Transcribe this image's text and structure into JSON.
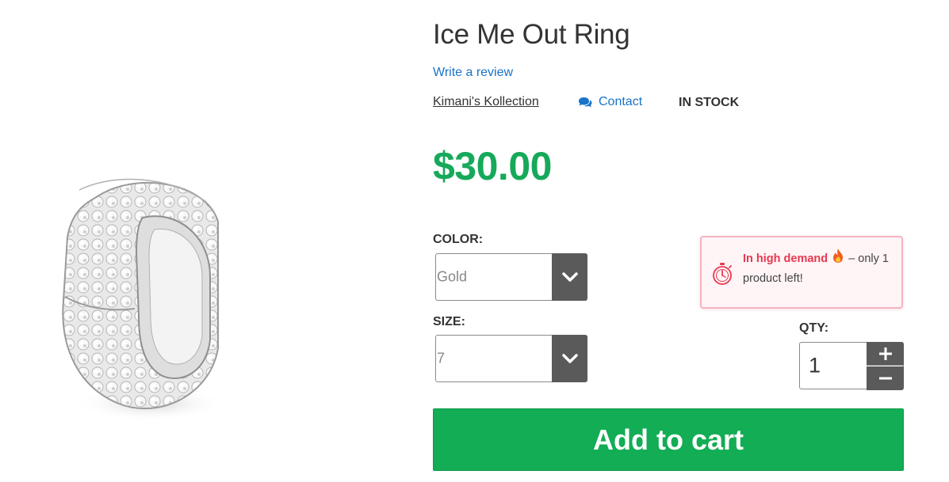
{
  "product": {
    "title": "Ice Me Out Ring",
    "review_link": "Write a review",
    "vendor": "Kimani's Kollection",
    "contact_label": "Contact",
    "stock_status": "IN STOCK",
    "price": "$30.00",
    "image_icon": "ring-image"
  },
  "options": {
    "color_label": "COLOR:",
    "color_value": "Gold",
    "size_label": "SIZE:",
    "size_value": "7"
  },
  "demand": {
    "hot_text": "In high demand",
    "rest_text": " – only 1 product left!",
    "icon": "stopwatch-icon"
  },
  "quantity": {
    "label": "QTY:",
    "value": "1"
  },
  "cart": {
    "button_label": "Add to cart"
  },
  "colors": {
    "price": "#16a95a",
    "link": "#1a73c9",
    "cart_button": "#12ad54",
    "demand_text": "#e8384f",
    "select_arrow_bg": "#5a5a5a"
  }
}
